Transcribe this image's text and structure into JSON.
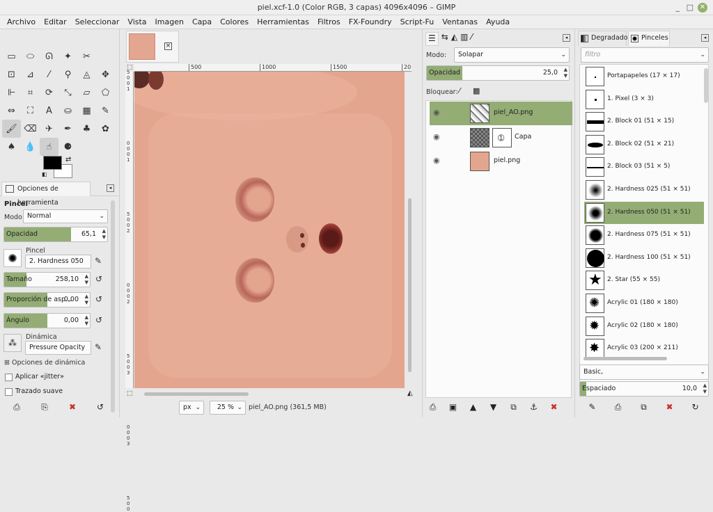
{
  "window": {
    "title": "piel.xcf-1.0 (Color RGB, 3 capas) 4096x4096 – GIMP",
    "minimize": "_",
    "maximize": "□",
    "close": "✕"
  },
  "menu": [
    "Archivo",
    "Editar",
    "Seleccionar",
    "Vista",
    "Imagen",
    "Capa",
    "Colores",
    "Herramientas",
    "Filtros",
    "FX-Foundry",
    "Script-Fu",
    "Ventanas",
    "Ayuda"
  ],
  "tools": [
    {
      "name": "rect-select-icon",
      "glyph": "▭"
    },
    {
      "name": "ellipse-select-icon",
      "glyph": "⬭"
    },
    {
      "name": "lasso-icon",
      "glyph": "ᘏ"
    },
    {
      "name": "fuzzy-select-icon",
      "glyph": "✦"
    },
    {
      "name": "scissors-icon",
      "glyph": "✂"
    },
    {
      "name": "spacer"
    },
    {
      "name": "foreground-select-icon",
      "glyph": "⊡"
    },
    {
      "name": "paths-icon",
      "glyph": "⊿"
    },
    {
      "name": "color-picker-icon",
      "glyph": "⁄"
    },
    {
      "name": "zoom-icon",
      "glyph": "⚲"
    },
    {
      "name": "measure-icon",
      "glyph": "◬"
    },
    {
      "name": "move-icon",
      "glyph": "✥"
    },
    {
      "name": "align-icon",
      "glyph": "⊩"
    },
    {
      "name": "crop-icon",
      "glyph": "⌗"
    },
    {
      "name": "rotate-icon",
      "glyph": "⟳"
    },
    {
      "name": "scale-icon",
      "glyph": "⤡"
    },
    {
      "name": "shear-icon",
      "glyph": "▱"
    },
    {
      "name": "perspective-icon",
      "glyph": "⬠"
    },
    {
      "name": "flip-icon",
      "glyph": "⇔"
    },
    {
      "name": "cage-icon",
      "glyph": "⛶"
    },
    {
      "name": "text-icon",
      "glyph": "A"
    },
    {
      "name": "bucket-fill-icon",
      "glyph": "⛀"
    },
    {
      "name": "blend-icon",
      "glyph": "▦"
    },
    {
      "name": "pencil-icon",
      "glyph": "✎"
    },
    {
      "name": "paintbrush-icon",
      "glyph": "🖌",
      "active": true
    },
    {
      "name": "eraser-icon",
      "glyph": "⌫"
    },
    {
      "name": "airbrush-icon",
      "glyph": "✈"
    },
    {
      "name": "ink-icon",
      "glyph": "✒"
    },
    {
      "name": "clone-icon",
      "glyph": "♣"
    },
    {
      "name": "heal-icon",
      "glyph": "✿"
    },
    {
      "name": "perspective-clone-icon",
      "glyph": "♠"
    },
    {
      "name": "blur-icon",
      "glyph": "💧"
    },
    {
      "name": "smudge-icon",
      "glyph": "☝",
      "active": true
    },
    {
      "name": "dodge-burn-icon",
      "glyph": "⚈"
    }
  ],
  "tool_options": {
    "tab_label": "Opciones de herramienta",
    "title": "Pincel",
    "mode_label": "Modo:",
    "mode_value": "Normal",
    "opacity": {
      "label": "Opacidad",
      "value": "65,1",
      "level": 0.651
    },
    "brush_label": "Pincel",
    "brush_value": "2. Hardness 050",
    "size": {
      "label": "Tamaño",
      "value": "258,10",
      "level": 0.258
    },
    "aspect": {
      "label": "Proporción de asp...",
      "value": "0,00",
      "level": 0.5
    },
    "angle": {
      "label": "Ángulo",
      "value": "0,00",
      "level": 0.5
    },
    "dynamics_label": "Dinámica",
    "dynamics_value": "Pressure Opacity",
    "dynamics_options": "Opciones de dinámica",
    "jitter": "Aplicar «jitter»",
    "smooth": "Trazado suave"
  },
  "canvas": {
    "ruler_ticks": [
      "500",
      "1000",
      "1500",
      "20"
    ],
    "left_ticks": [
      "5",
      "0",
      "0",
      "1",
      "0",
      "0",
      "0",
      "1",
      "5",
      "0",
      "0",
      "2",
      "0",
      "0",
      "0",
      "2",
      "5",
      "0",
      "0",
      "3",
      "0",
      "0",
      "0",
      "3",
      "5",
      "0",
      "0"
    ],
    "unit": "px",
    "zoom": "25 %",
    "status_text": "piel_AO.png (361,5 MB)"
  },
  "layers": {
    "mode_label": "Modo:",
    "mode_value": "Solapar",
    "opacity_label": "Opacidad",
    "opacity_value": "25,0",
    "opacity_level": 0.25,
    "lock_label": "Bloquear:",
    "items": [
      {
        "name": "piel_AO.png"
      },
      {
        "name": "Capa"
      },
      {
        "name": "piel.png"
      }
    ]
  },
  "brushes_panel": {
    "tab_gradients": "Degradados",
    "tab_brushes": "Pinceles",
    "filter_placeholder": "filtro",
    "items": [
      "Portapapeles (17 × 17)",
      "1. Pixel (3 × 3)",
      "2. Block 01 (51 × 15)",
      "2. Block 02 (51 × 21)",
      "2. Block 03 (51 × 5)",
      "2. Hardness 025 (51 × 51)",
      "2. Hardness 050 (51 × 51)",
      "2. Hardness 075 (51 × 51)",
      "2. Hardness 100 (51 × 51)",
      "2. Star (55 × 55)",
      "Acrylic 01 (180 × 180)",
      "Acrylic 02 (180 × 180)",
      "Acrylic 03 (200 × 211)"
    ],
    "selected_index": 6,
    "preset_value": "Basic,",
    "spacing_label": "Espaciado",
    "spacing_value": "10,0",
    "spacing_level": 0.05
  },
  "colors": {
    "accent": "#93ad74",
    "skin": "#e3a58e"
  }
}
